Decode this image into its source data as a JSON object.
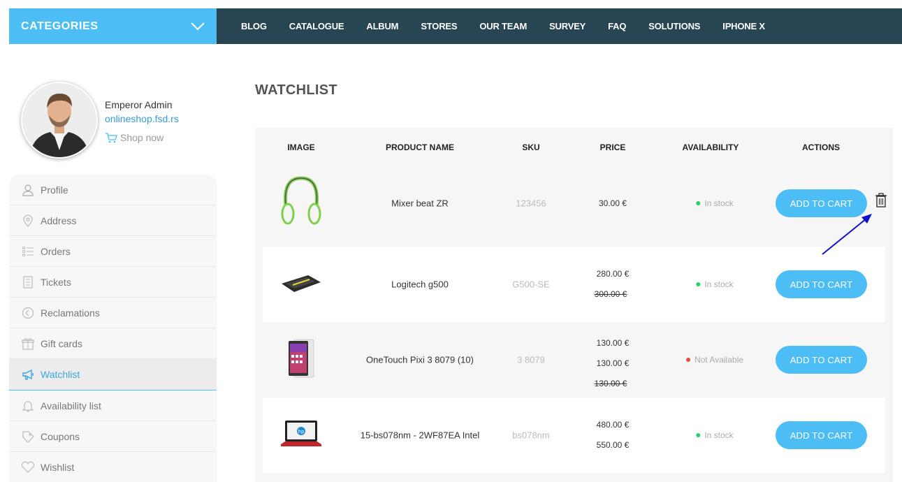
{
  "nav": {
    "categories_label": "CATEGORIES",
    "links": [
      "BLOG",
      "CATALOGUE",
      "ALBUM",
      "STORES",
      "OUR TEAM",
      "SURVEY",
      "FAQ",
      "SOLUTIONS",
      "IPHONE X"
    ],
    "bar_color": "#284554",
    "accent_color": "#4dbdf5"
  },
  "profile": {
    "name": "Emperor Admin",
    "site": "onlineshop.fsd.rs",
    "shop_now": "Shop now"
  },
  "sidebar": {
    "items": [
      {
        "label": "Profile",
        "icon": "user-icon"
      },
      {
        "label": "Address",
        "icon": "location-pin-icon"
      },
      {
        "label": "Orders",
        "icon": "list-icon"
      },
      {
        "label": "Tickets",
        "icon": "ticket-icon"
      },
      {
        "label": "Reclamations",
        "icon": "back-arrow-circle-icon"
      },
      {
        "label": "Gift cards",
        "icon": "gift-icon"
      },
      {
        "label": "Watchlist",
        "icon": "megaphone-icon",
        "active": true
      },
      {
        "label": "Availability list",
        "icon": "bell-icon"
      },
      {
        "label": "Coupons",
        "icon": "tag-icon"
      },
      {
        "label": "Wishlist",
        "icon": "heart-icon"
      }
    ]
  },
  "main": {
    "title": "WATCHLIST",
    "columns": [
      "IMAGE",
      "PRODUCT NAME",
      "SKU",
      "PRICE",
      "AVAILABILITY",
      "ACTIONS"
    ],
    "add_to_cart_label": "ADD TO CART",
    "rows": [
      {
        "name": "Mixer beat ZR",
        "sku": "123456",
        "prices": [
          "30.00 €"
        ],
        "old_price": "",
        "availability": "In stock",
        "available": true,
        "image": "headphones-image"
      },
      {
        "name": "Logitech g500",
        "sku": "G500-SE",
        "prices": [
          "280.00 €"
        ],
        "old_price": "300.00 €",
        "availability": "In stock",
        "available": true,
        "image": "keyboard-image"
      },
      {
        "name": "OneTouch Pixi 3 8079 (10)",
        "sku": "3 8079",
        "prices": [
          "130.00 €",
          "130.00 €"
        ],
        "old_price": "130.00 €",
        "availability": "Not Available",
        "available": false,
        "image": "tablet-image"
      },
      {
        "name": "15-bs078nm - 2WF87EA Intel",
        "sku": "bs078nm",
        "prices": [
          "480.00 €",
          "550.00 €"
        ],
        "old_price": "",
        "availability": "In stock",
        "available": true,
        "image": "laptop-image"
      }
    ],
    "colors": {
      "in_stock": "#2ecc71",
      "not_available": "#e74c3c",
      "arrow": "#1111cc"
    }
  }
}
